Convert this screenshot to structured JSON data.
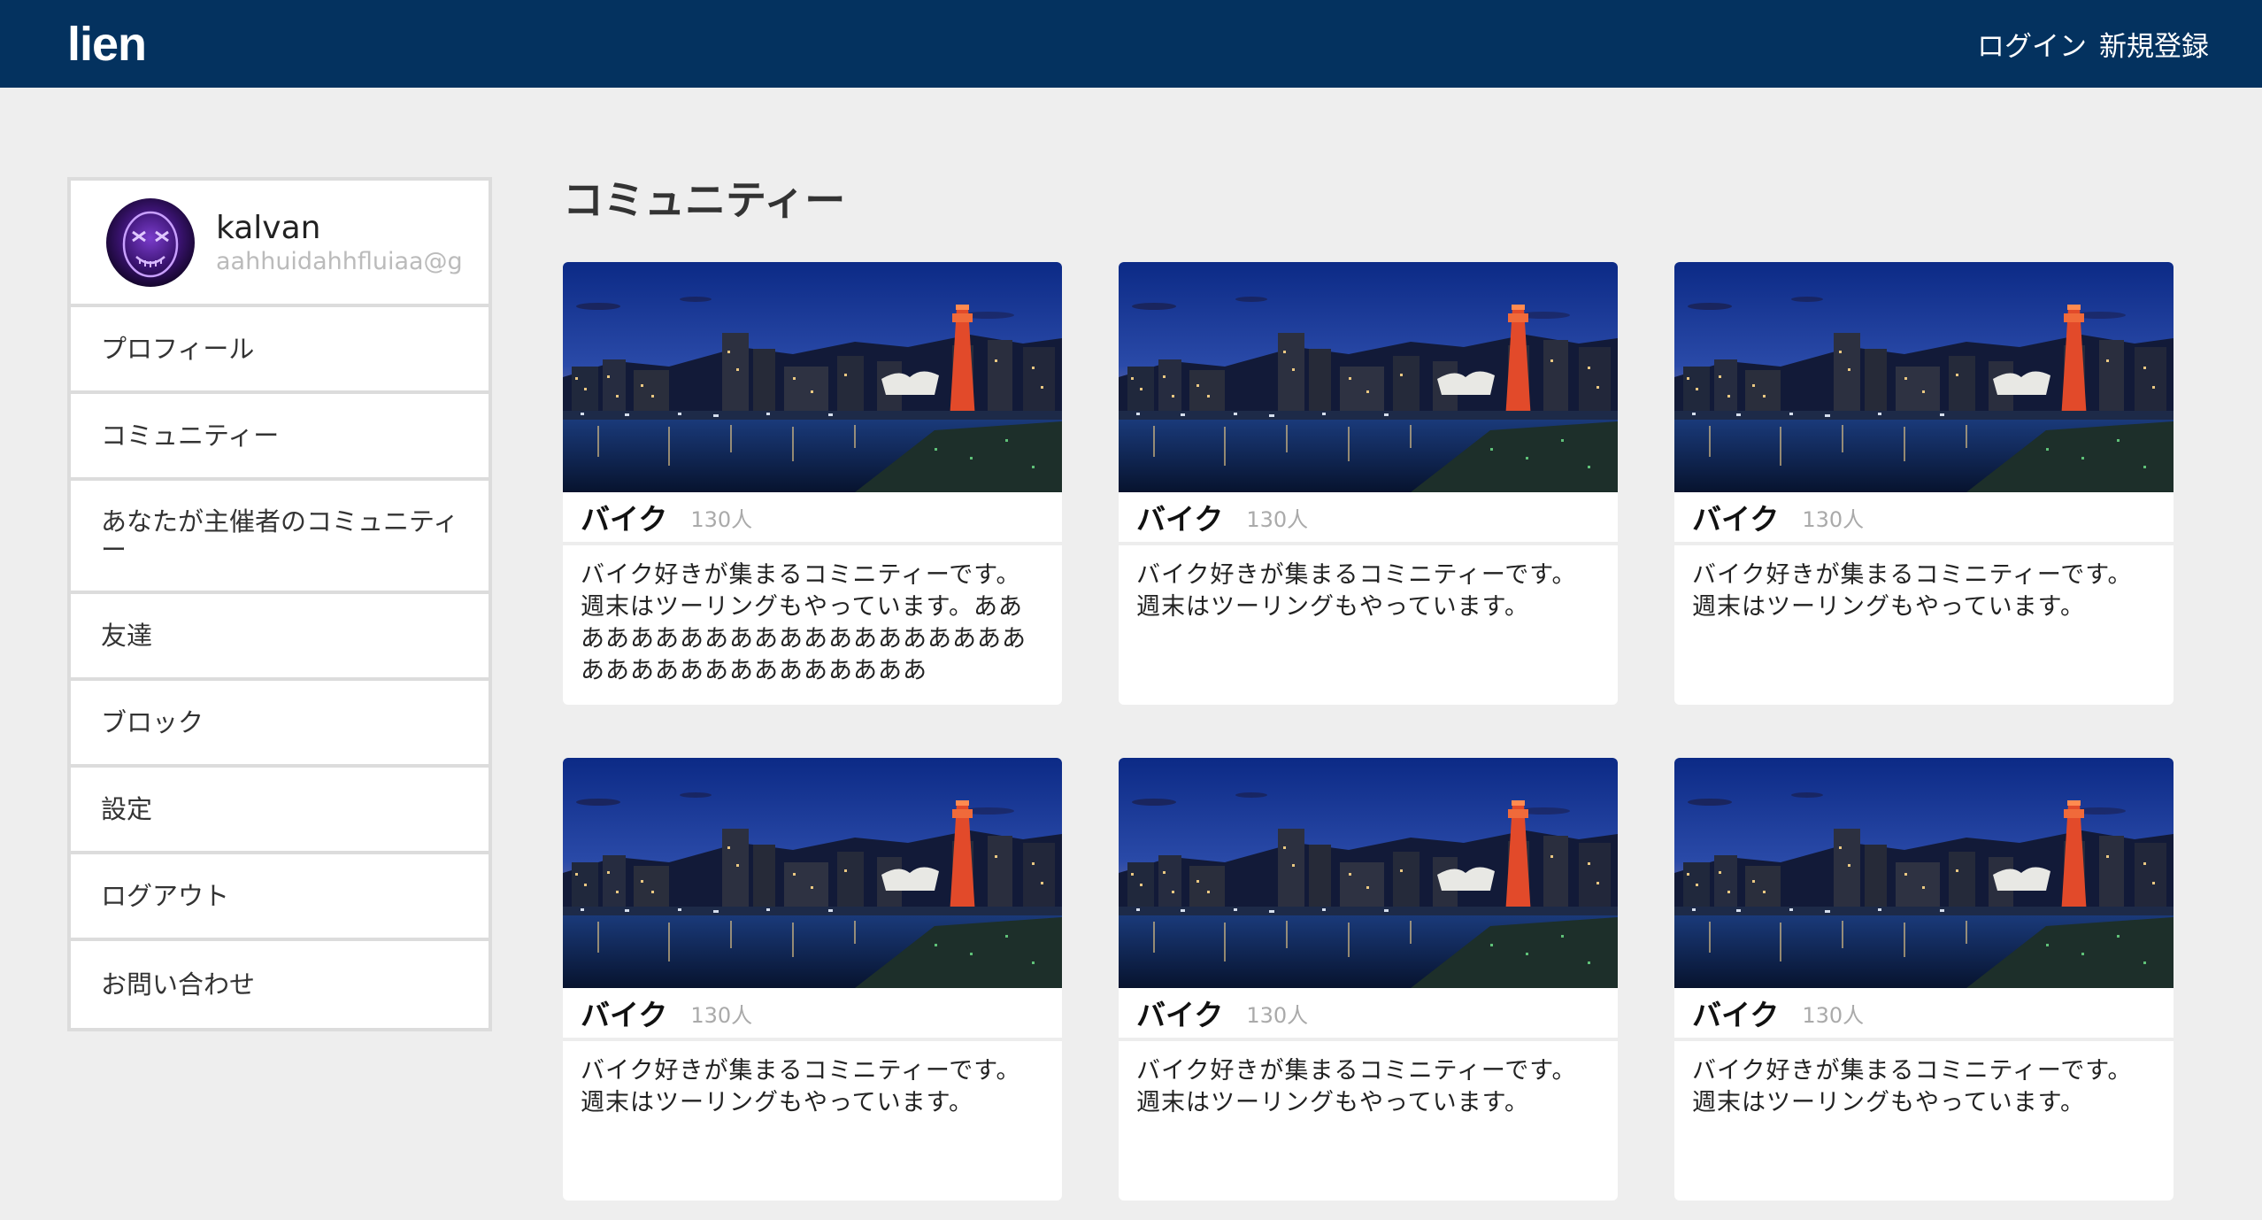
{
  "header": {
    "logo": "lien",
    "login_label": "ログイン",
    "signup_label": "新規登録"
  },
  "user": {
    "name": "kalvan",
    "email": "aahhuidahhfluiaa@g"
  },
  "sidebar": {
    "items": [
      {
        "label": "プロフィール"
      },
      {
        "label": "コミュニティー"
      },
      {
        "label": "あなたが主催者のコミュニティー"
      },
      {
        "label": "友達"
      },
      {
        "label": "ブロック"
      },
      {
        "label": "設定"
      },
      {
        "label": "ログアウト"
      },
      {
        "label": "お問い合わせ"
      }
    ]
  },
  "main": {
    "title": "コミュニティー",
    "cards": [
      {
        "title": "バイク",
        "count": "130人",
        "description": "バイク好きが集まるコミニティーです。週末はツーリングもやっています。ああああああああああああああああああああああああああああああああああ"
      },
      {
        "title": "バイク",
        "count": "130人",
        "description": "バイク好きが集まるコミニティーです。週末はツーリングもやっています。"
      },
      {
        "title": "バイク",
        "count": "130人",
        "description": "バイク好きが集まるコミニティーです。週末はツーリングもやっています。"
      },
      {
        "title": "バイク",
        "count": "130人",
        "description": "バイク好きが集まるコミニティーです。週末はツーリングもやっています。"
      },
      {
        "title": "バイク",
        "count": "130人",
        "description": "バイク好きが集まるコミニティーです。週末はツーリングもやっています。"
      },
      {
        "title": "バイク",
        "count": "130人",
        "description": "バイク好きが集まるコミニティーです。週末はツーリングもやっています。"
      }
    ]
  }
}
